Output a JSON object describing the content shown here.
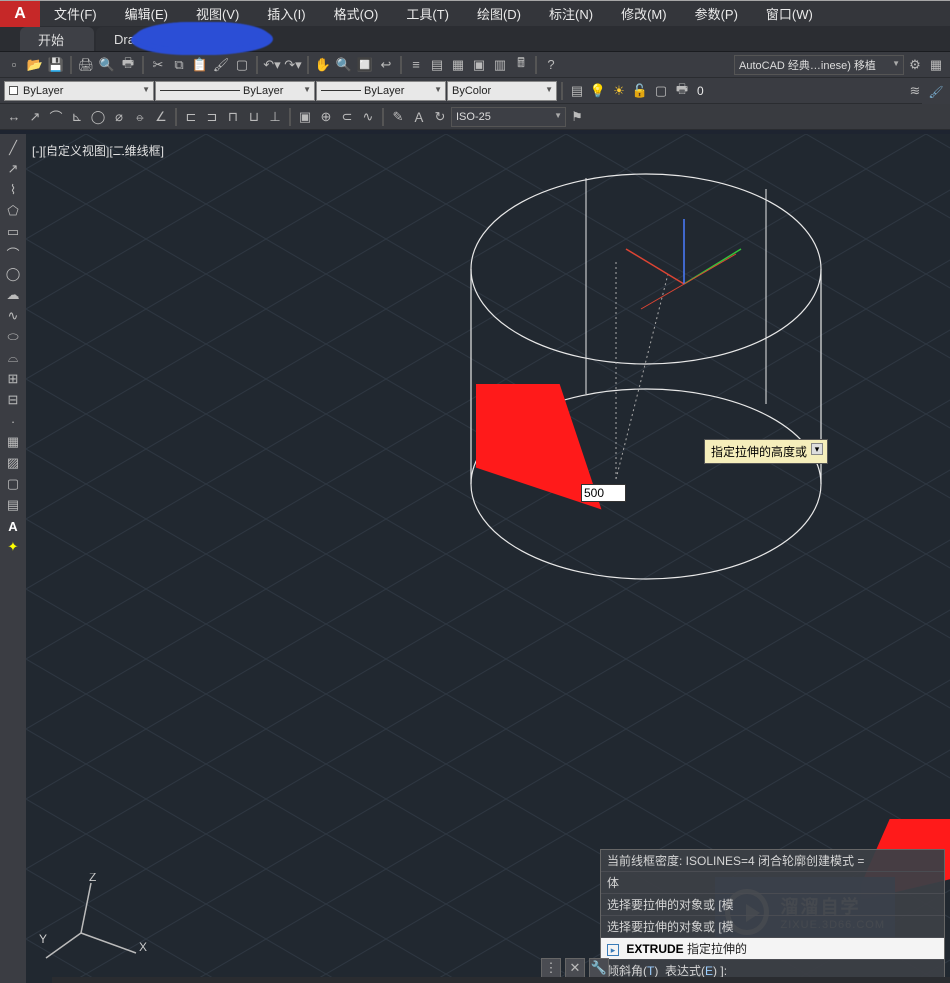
{
  "menu": {
    "items": [
      "文件(F)",
      "编辑(E)",
      "视图(V)",
      "插入(I)",
      "格式(O)",
      "工具(T)",
      "绘图(D)",
      "标注(N)",
      "修改(M)",
      "参数(P)",
      "窗口(W)"
    ]
  },
  "tabs": {
    "start": "开始",
    "drawing": "Drawing4*"
  },
  "workspace_box": "AutoCAD 经典…inese) 移植",
  "layer_row": {
    "layer_dd": "ByLayer",
    "linetype_dd": "ByLayer",
    "lineweight_dd": "ByLayer",
    "color_dd": "ByColor",
    "count": "0"
  },
  "dimstyle_dd": "ISO-25",
  "viewport_label": "[-][自定义视图][二维线框]",
  "input_value": "500",
  "tooltip_text": "指定拉伸的高度或",
  "cmd": {
    "l1": "当前线框密度:  ISOLINES=4   闭合轮廓创建模式 =",
    "l2": "体",
    "l3_pre": "选择要拉伸的对象或  [模",
    "l4_pre": "选择要拉伸的对象或  [模",
    "prompt_cmd": "EXTRUDE",
    "prompt_text": "指定拉伸的",
    "bottom_line": "倾斜角(T)  表达式(E) ]:",
    "opt_t": "T",
    "opt_e": "E"
  },
  "brand": {
    "cn": "溜溜自学",
    "en": "ZIXUE.3D66.COM"
  },
  "ucs": {
    "x": "X",
    "y": "Y",
    "z": "Z"
  }
}
